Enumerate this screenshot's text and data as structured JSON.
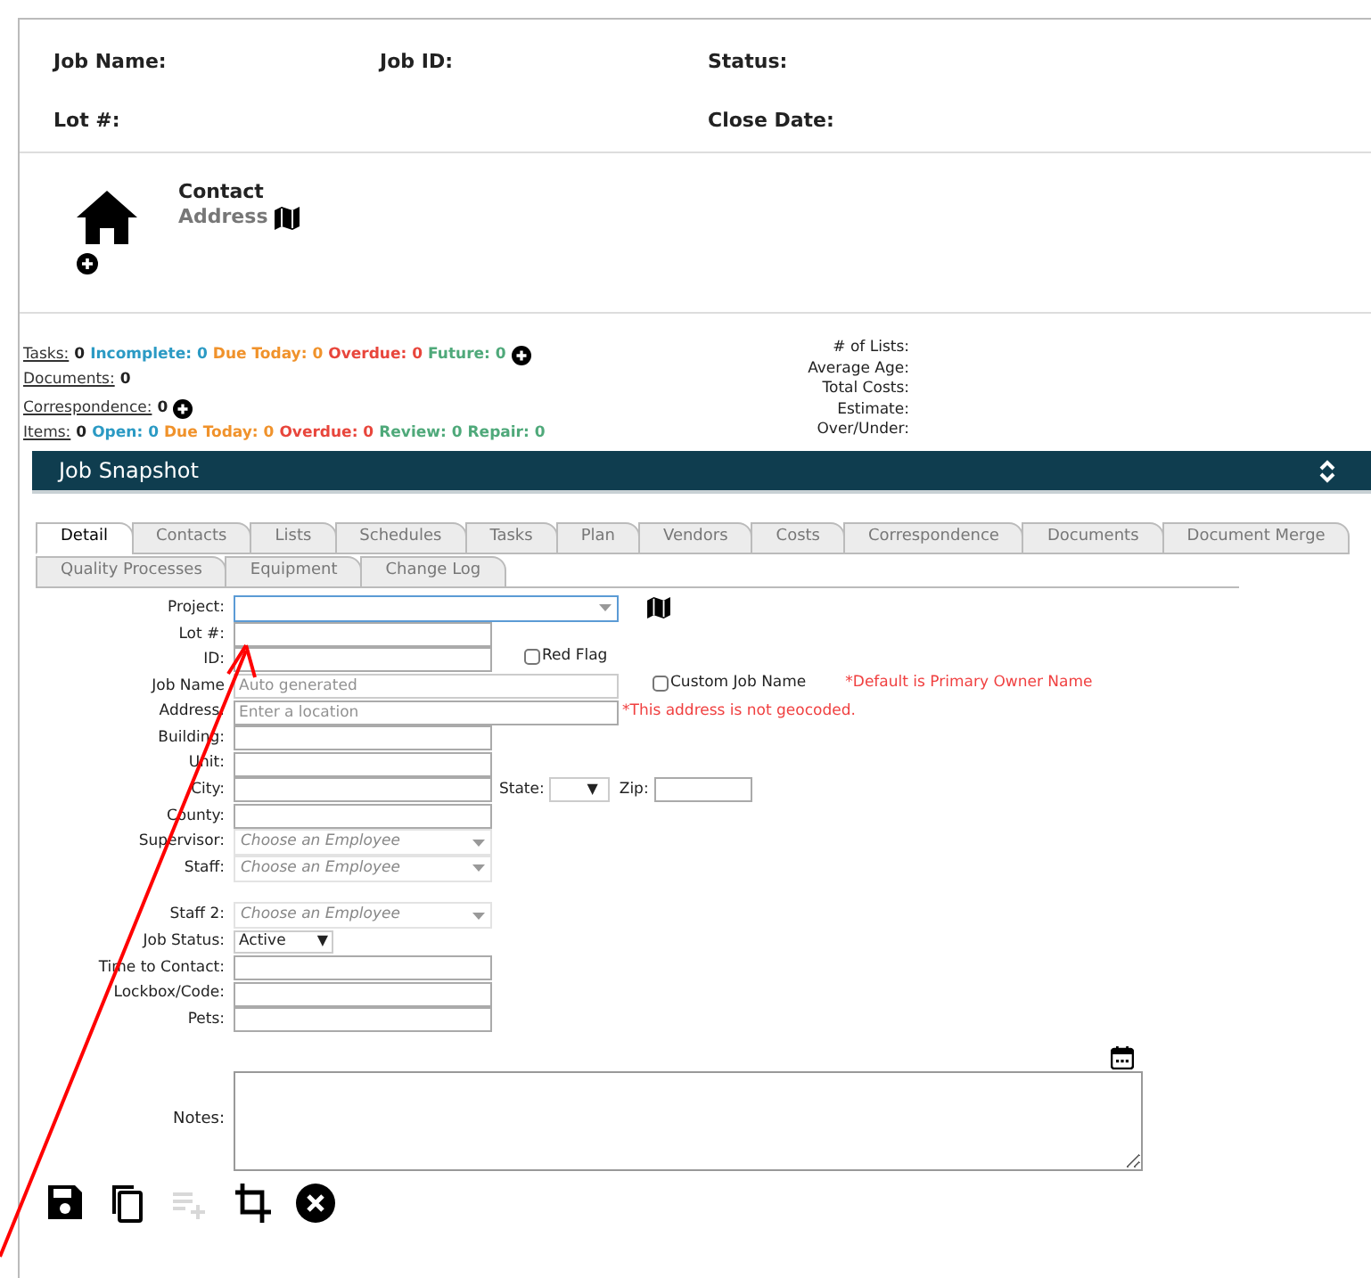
{
  "header": {
    "fields": [
      {
        "label": "Job Name:"
      },
      {
        "label": "Job ID:"
      },
      {
        "label": "Status:"
      },
      {
        "label": "Lot #:"
      },
      {
        "label": "Close Date:"
      }
    ]
  },
  "contact": {
    "title": "Contact",
    "address": "Address"
  },
  "stats": {
    "lines": [
      {
        "label": "Tasks:",
        "value": "0",
        "add": true,
        "counts": [
          {
            "text": "Incomplete: 0",
            "color": "#2b9ac4"
          },
          {
            "text": "Due Today: 0",
            "color": "#f0922b"
          },
          {
            "text": "Overdue: 0",
            "color": "#e8463c"
          },
          {
            "text": "Future: 0",
            "color": "#4fa97a"
          }
        ]
      },
      {
        "label": "Documents:",
        "value": "0",
        "add": false
      },
      {
        "label": "Correspondence:",
        "value": "0",
        "add": true
      },
      {
        "label": "Items:",
        "value": "0",
        "add": false,
        "counts": [
          {
            "text": "Open: 0",
            "color": "#2b9ac4"
          },
          {
            "text": "Due Today: 0",
            "color": "#f0922b"
          },
          {
            "text": "Overdue: 0",
            "color": "#e8463c"
          },
          {
            "text": "Review: 0",
            "color": "#4fa97a"
          },
          {
            "text": "Repair: 0",
            "color": "#4fa97a"
          }
        ]
      }
    ],
    "summary": [
      "# of Lists:",
      "Average Age:",
      "Total Costs:",
      "Estimate:",
      "Over/Under:"
    ]
  },
  "snapshot": {
    "title": "Job Snapshot"
  },
  "tabs": [
    [
      {
        "label": "Detail",
        "selected": true
      },
      {
        "label": "Contacts",
        "selected": false
      },
      {
        "label": "Lists",
        "selected": false
      },
      {
        "label": "Schedules",
        "selected": false
      },
      {
        "label": "Tasks",
        "selected": false
      },
      {
        "label": "Plan",
        "selected": false
      },
      {
        "label": "Vendors",
        "selected": false
      },
      {
        "label": "Costs",
        "selected": false
      },
      {
        "label": "Correspondence",
        "selected": false
      },
      {
        "label": "Documents",
        "selected": false
      },
      {
        "label": "Document Merge",
        "selected": false
      }
    ],
    [
      {
        "label": "Quality Processes",
        "selected": false
      },
      {
        "label": "Equipment",
        "selected": false
      },
      {
        "label": "Change Log",
        "selected": false
      }
    ]
  ],
  "form": [
    {
      "kind": "project",
      "label": "Project:"
    },
    {
      "kind": "text",
      "label": "Lot #:"
    },
    {
      "kind": "text",
      "label": "ID:",
      "checkbox": {
        "label": "Red Flag",
        "checked": false
      }
    },
    {
      "kind": "wide",
      "label": "Job Name",
      "placeholder": "Auto generated",
      "disabled": true,
      "checkbox": {
        "label": "Custom Job Name",
        "checked": false
      },
      "note": "*Default is Primary Owner Name"
    },
    {
      "kind": "wide",
      "label": "Address:",
      "placeholder": "Enter a location",
      "disabled": false,
      "note": "*This address is not geocoded."
    },
    {
      "kind": "text",
      "label": "Building:"
    },
    {
      "kind": "text",
      "label": "Unit:"
    },
    {
      "kind": "city",
      "label": "City:",
      "state_label": "State:",
      "state_arrow": "▼",
      "zip_label": "Zip:"
    },
    {
      "kind": "text",
      "label": "County:"
    },
    {
      "kind": "combo",
      "label": "Supervisor:",
      "placeholder": "Choose an Employee"
    },
    {
      "kind": "combo",
      "label": "Staff:",
      "placeholder": "Choose an Employee"
    },
    {
      "kind": "spacer"
    },
    {
      "kind": "combo",
      "label": "Staff 2:",
      "placeholder": "Choose an Employee"
    },
    {
      "kind": "select",
      "label": "Job Status:",
      "value": "Active",
      "arrow": "▼"
    },
    {
      "kind": "text",
      "label": "Time to Contact:"
    },
    {
      "kind": "text",
      "label": "Lockbox/Code:"
    },
    {
      "kind": "text",
      "label": "Pets:"
    }
  ],
  "notes": {
    "label": "Notes:"
  },
  "toolbar": [
    {
      "kind": "save",
      "disabled": false
    },
    {
      "kind": "copy",
      "disabled": false
    },
    {
      "kind": "add-list",
      "disabled": true
    },
    {
      "kind": "crop",
      "disabled": false
    },
    {
      "kind": "cancel",
      "disabled": false
    }
  ]
}
